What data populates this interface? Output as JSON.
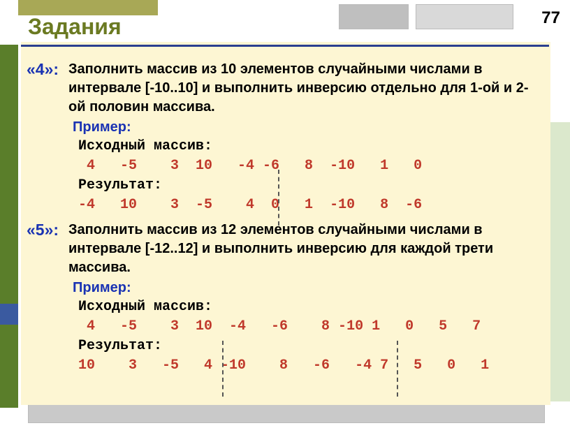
{
  "page_number": "77",
  "heading": "Задания",
  "task4": {
    "label": "«4»:",
    "text": "Заполнить массив из 10 элементов случайными числами в интервале [-10..10] и выполнить инверсию отдельно для 1-ой и 2-ой половин массива.",
    "example_label": "Пример:",
    "input_label": "Исходный массив:",
    "input_row_a": " 4   -5    3  10   -4",
    "input_row_b": " -6   8  -10   1   0",
    "result_label": "Результат:",
    "result_row_a": "-4   10    3  -5    4",
    "result_row_b": "  0   1  -10   8  -6"
  },
  "task5": {
    "label": "«5»:",
    "text": "Заполнить массив из 12 элементов случайными числами в интервале [-12..12] и выполнить инверсию для каждой трети массива.",
    "example_label": "Пример:",
    "input_label": "Исходный массив:",
    "input_row_a": " 4   -5    3  10",
    "input_row_b": "  -4   -6    8 -10",
    "input_row_c": " 1   0   5   7",
    "result_label": "Результат:",
    "result_row_a": "10    3   -5   4",
    "result_row_b": " -10    8   -6   -4",
    "result_row_c": " 7   5   0   1"
  }
}
